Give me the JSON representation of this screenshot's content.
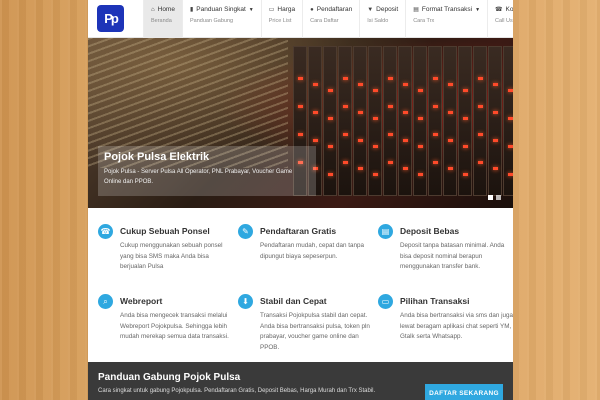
{
  "logo": {
    "text": "Pp",
    "color": "#1d34b8"
  },
  "nav": [
    {
      "icon": "home-icon",
      "glyph": "⌂",
      "label": "Home",
      "sub": "Beranda",
      "dropdown": false,
      "active": true
    },
    {
      "icon": "bookmark-icon",
      "glyph": "▮",
      "label": "Panduan Singkat",
      "sub": "Panduan Gabung",
      "dropdown": true,
      "active": false
    },
    {
      "icon": "money-icon",
      "glyph": "▭",
      "label": "Harga",
      "sub": "Price List",
      "dropdown": false,
      "active": false
    },
    {
      "icon": "user-icon",
      "glyph": "●",
      "label": "Pendaftaran",
      "sub": "Cara Daftar",
      "dropdown": false,
      "active": false
    },
    {
      "icon": "cart-icon",
      "glyph": "▼",
      "label": "Deposit",
      "sub": "Isi Saldo",
      "dropdown": false,
      "active": false
    },
    {
      "icon": "list-icon",
      "glyph": "▤",
      "label": "Format Transaksi",
      "sub": "Cara Trx",
      "dropdown": true,
      "active": false
    },
    {
      "icon": "phone-icon",
      "glyph": "☎",
      "label": "Kontak",
      "sub": "Call Us",
      "dropdown": false,
      "active": false
    }
  ],
  "hero": {
    "title": "Pojok Pulsa Elektrik",
    "text": "Pojok Pulsa - Server Pulsa All Operator, PNL Prabayar, Voucher Game Online dan PPOB."
  },
  "features": [
    {
      "icon": "phone-icon",
      "glyph": "☎",
      "title": "Cukup Sebuah Ponsel",
      "text": "Cukup menggunakan sebuah ponsel yang bisa SMS maka Anda bisa berjualan Pulsa"
    },
    {
      "icon": "pencil-icon",
      "glyph": "✎",
      "title": "Pendaftaran Gratis",
      "text": "Pendaftaran mudah, cepat dan tanpa dipungut biaya sepeserpun."
    },
    {
      "icon": "document-icon",
      "glyph": "▤",
      "title": "Deposit Bebas",
      "text": "Deposit tanpa batasan minimal. Anda bisa deposit nominal berapun menggunakan transfer bank."
    },
    {
      "icon": "search-icon",
      "glyph": "⌕",
      "title": "Webreport",
      "text": "Anda bisa mengecek transaksi melalui Webreport Pojokpulsa. Sehingga lebih mudah merekap semua data transaksi."
    },
    {
      "icon": "download-icon",
      "glyph": "⬇",
      "title": "Stabil dan Cepat",
      "text": "Transaksi Pojokpulsa stabil dan cepat. Anda bisa bertransaksi pulsa, token pln prabayar, voucher game online dan PPOB."
    },
    {
      "icon": "monitor-icon",
      "glyph": "▭",
      "title": "Pilihan Transaksi",
      "text": "Anda bisa bertransaksi via sms dan juga lewat beragam aplikasi chat seperti YM, Gtalk serta Whatsapp."
    }
  ],
  "cta": {
    "title": "Panduan Gabung Pojok Pulsa",
    "text": "Cara singkat untuk gabung Pojokpulsa. Pendaftaran Gratis, Deposit Bebas, Harga Murah dan Trx Stabil.",
    "button": "DAFTAR SEKARANG"
  },
  "colors": {
    "accent": "#2fa8e0",
    "footer": "#3a3a3a"
  }
}
